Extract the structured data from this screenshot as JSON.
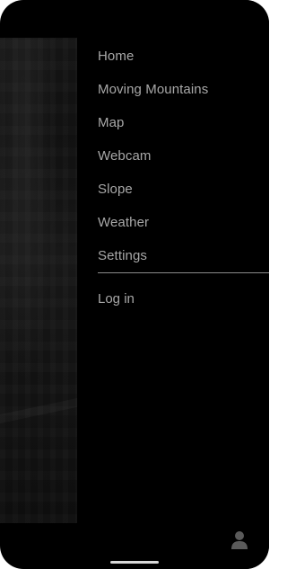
{
  "menu": {
    "items": [
      {
        "label": "Home"
      },
      {
        "label": "Moving Mountains"
      },
      {
        "label": "Map"
      },
      {
        "label": "Webcam"
      },
      {
        "label": "Slope"
      },
      {
        "label": "Weather"
      },
      {
        "label": "Settings"
      }
    ],
    "login_label": "Log in"
  },
  "icons": {
    "profile": "user-icon"
  },
  "colors": {
    "screen_bg": "#000000",
    "menu_text": "#a8a8a8",
    "divider": "#8a8a8a",
    "home_indicator": "#d9d9d9"
  }
}
